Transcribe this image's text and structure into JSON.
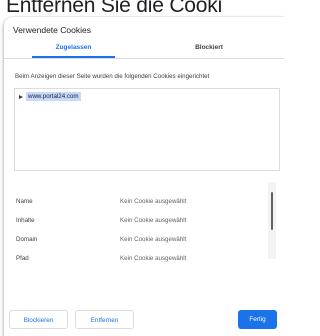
{
  "background": {
    "heading": "Entfernen Sie die Cooki"
  },
  "dialog": {
    "title": "Verwendete Cookies",
    "tabs": [
      {
        "label": "Zugelassen",
        "active": true
      },
      {
        "label": "Blockiert",
        "active": false
      }
    ],
    "info_text": "Beim Anzeigen dieser Seite wurden die folgenden Cookies eingerichtet",
    "tree": {
      "items": [
        {
          "host": "www.portal24.com",
          "selected": true,
          "expand_icon": "triangle-right-icon"
        }
      ]
    },
    "details": [
      {
        "label": "Name",
        "value": "Kein Cookie ausgewählt"
      },
      {
        "label": "Inhalte",
        "value": "Kein Cookie ausgewählt"
      },
      {
        "label": "Domain",
        "value": "Kein Cookie ausgewählt"
      },
      {
        "label": "Pfad",
        "value": "Kein Cookie ausgewählt"
      }
    ],
    "buttons": {
      "block": "Blockieren",
      "remove": "Entfernen",
      "done": "Fertig"
    }
  },
  "colors": {
    "accent": "#1a73e8",
    "selection": "#c6dafc",
    "border": "#dadce0"
  }
}
